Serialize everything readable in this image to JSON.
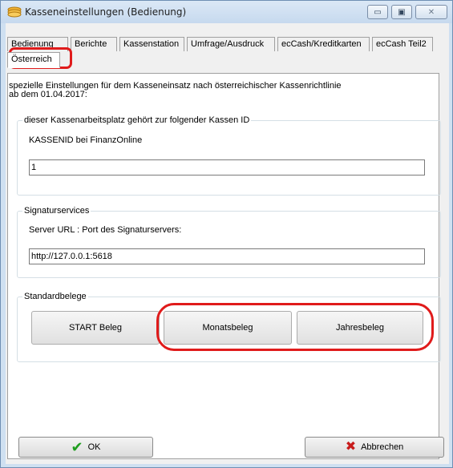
{
  "window": {
    "title": "Kasseneinstellungen (Bedienung)",
    "controls": {
      "minimize": "▭",
      "maximize": "▣",
      "close": "✕"
    }
  },
  "tabs": [
    {
      "label": "Bedienung"
    },
    {
      "label": "Berichte"
    },
    {
      "label": "Kassenstation"
    },
    {
      "label": "Umfrage/Ausdruck"
    },
    {
      "label": "ecCash/Kreditkarten"
    },
    {
      "label": "ecCash Teil2"
    },
    {
      "label": "Österreich",
      "active": true
    }
  ],
  "panel": {
    "description_line1": "spezielle Einstellungen für dem Kasseneinsatz nach österreichischer Kassenrichtlinie",
    "description_line2": "ab dem 01.04.2017:",
    "kassen_group": {
      "legend": "dieser Kassenarbeitsplatz gehört zur folgender Kassen ID",
      "label": "KASSENID bei FinanzOnline",
      "value": "1"
    },
    "signatur_group": {
      "legend": "Signaturservices",
      "label": "Server URL : Port des Signaturservers:",
      "value": "http://127.0.0.1:5618"
    },
    "belege_group": {
      "legend": "Standardbelege",
      "buttons": [
        "START Beleg",
        "Monatsbeleg",
        "Jahresbeleg"
      ]
    }
  },
  "footer": {
    "ok_label": "OK",
    "cancel_label": "Abbrechen"
  },
  "colors": {
    "highlight": "#e01b1b",
    "ok_icon": "#1f9e1f",
    "cancel_icon": "#c81c1c"
  },
  "icons": {
    "app": "coins-icon",
    "ok": "checkmark-icon",
    "cancel": "x-icon"
  }
}
